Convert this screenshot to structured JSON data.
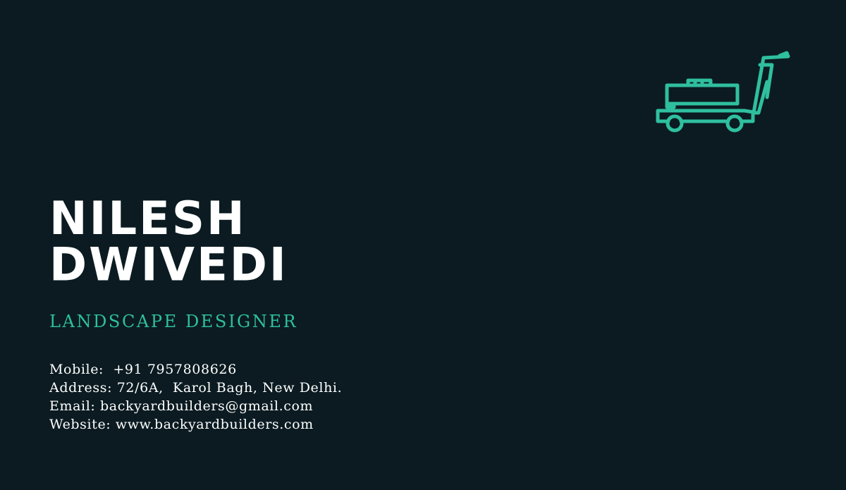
{
  "card": {
    "name_line_1": "NILESH",
    "name_line_2": "DWIVEDI",
    "title": "LANDSCAPE DESIGNER",
    "contact": {
      "mobile": "Mobile:  +91 7957808626",
      "address": "Address: 72/6A,  Karol Bagh, New Delhi.",
      "email": "Email: backyardbuilders@gmail.com",
      "website": "Website: www.backyardbuilders.com"
    },
    "logo_icon": "lawn-mower-icon"
  },
  "colors": {
    "background": "#0b1b21",
    "accent": "#2fbf9f",
    "text": "#ffffff"
  }
}
